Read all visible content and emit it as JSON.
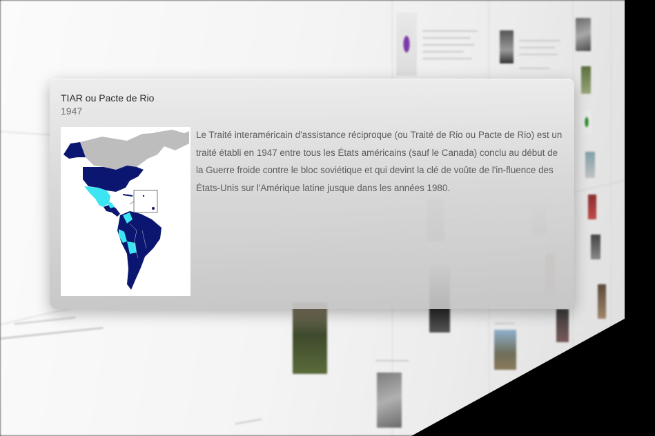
{
  "popover": {
    "title": "TIAR ou Pacte de Rio",
    "year": "1947",
    "image_alt": "Carte des États signataires du TIAR",
    "description": "Le Traité interaméricain d'assistance réciproque (ou Traité de Rio ou Pacte de Rio) est un traité établi en 1947 entre tous les États américains (sauf le Canada) conclu au début de la Guerre froide contre le bloc soviétique et qui devint la clé de voûte de l'in-fluence des États-Unis sur l'Amérique latine jusque dans les années 1980."
  },
  "map_colors": {
    "members": "#0b1670",
    "former_members": "#3be6f2",
    "non_members": "#bdbdbd",
    "background": "#ffffff"
  }
}
